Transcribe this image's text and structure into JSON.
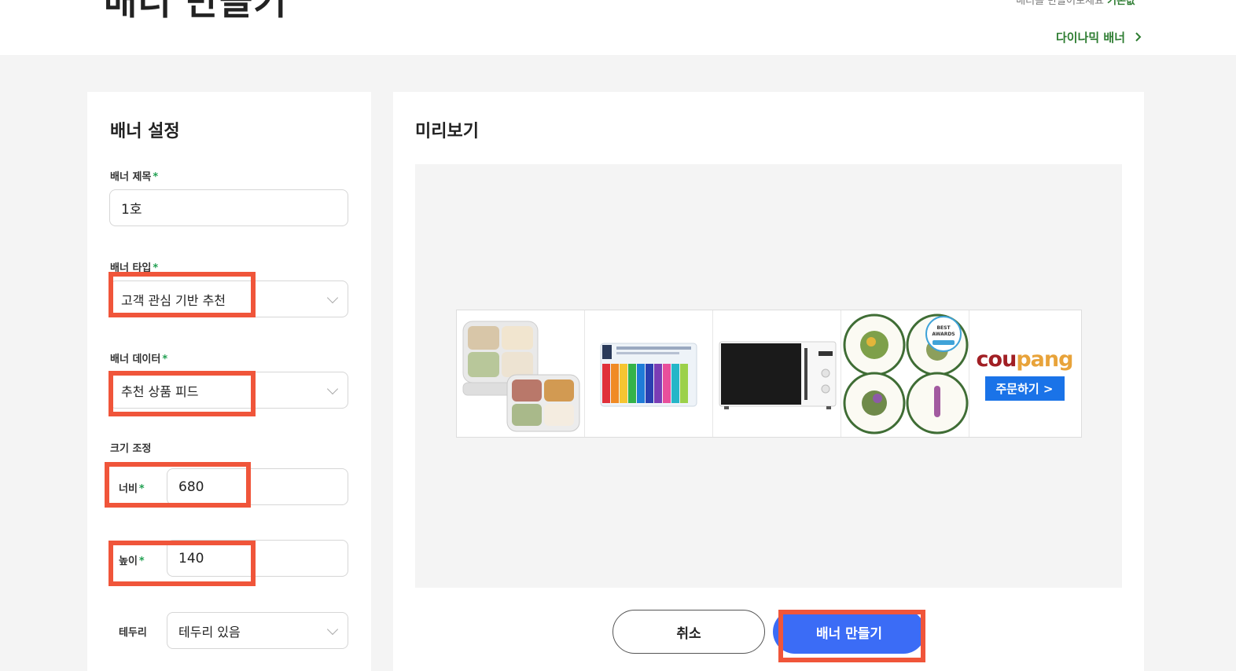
{
  "header": {
    "title": "배너 만들기",
    "top_right_partial": "배너를 만들어보세요",
    "top_right_partial_bold": "기본값",
    "dynamic_banner_link": "다이나믹 배너",
    "chevron_icon": "chevron-right-icon"
  },
  "settings": {
    "section_title": "배너 설정",
    "banner_title_label": "배너 제목",
    "banner_title_value": "1호",
    "banner_type_label": "배너 타입",
    "banner_type_value": "고객 관심 기반 추천",
    "banner_data_label": "배너 데이터",
    "banner_data_value": "추천 상품 피드",
    "size_label": "크기 조정",
    "width_label": "너비",
    "width_value": "680",
    "height_label": "높이",
    "height_value": "140",
    "border_label": "테두리",
    "border_value": "테두리 있음",
    "required_mark": "*"
  },
  "preview": {
    "section_title": "미리보기",
    "products": [
      {
        "name": "food-container-product",
        "icon": "food-container-image"
      },
      {
        "name": "toothbrush-product",
        "icon": "toothbrush-pack-image"
      },
      {
        "name": "microwave-product",
        "icon": "microwave-image"
      },
      {
        "name": "plates-product",
        "icon": "decorative-plates-image",
        "badge_top": "BEST",
        "badge_main": "AWARDS"
      }
    ],
    "logo_text_c": "cou",
    "logo_text_p": "pang",
    "order_button": "주문하기 >"
  },
  "actions": {
    "cancel": "취소",
    "create": "배너 만들기"
  },
  "colors": {
    "accent_green": "#2e7d32",
    "primary_blue": "#3b6cf6",
    "highlight_red": "#f0553a",
    "coupang_red": "#a11f24",
    "coupang_blue": "#1a73e8"
  }
}
